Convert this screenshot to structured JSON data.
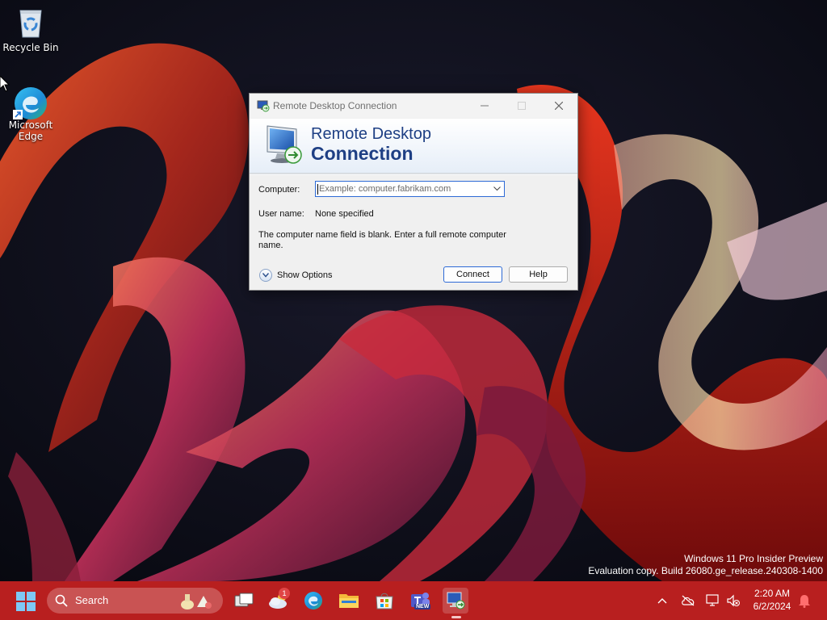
{
  "desktop": {
    "icons": [
      {
        "label": "Recycle Bin",
        "icon": "recycle-bin-icon"
      },
      {
        "label": "Microsoft\nEdge",
        "icon": "edge-icon"
      }
    ],
    "watermark": {
      "line1": "Windows 11 Pro Insider Preview",
      "line2": "Evaluation copy. Build 26080.ge_release.240308-1400"
    }
  },
  "window": {
    "title": "Remote Desktop Connection",
    "banner_line1": "Remote Desktop",
    "banner_line2": "Connection",
    "computer_label": "Computer:",
    "computer_value": "",
    "computer_placeholder": "Example: computer.fabrikam.com",
    "username_label": "User name:",
    "username_value": "None specified",
    "message": "The computer name field is blank.  Enter a full remote computer name.",
    "show_options_label": "Show Options",
    "connect_label": "Connect",
    "help_label": "Help",
    "accent": "#1e3f84"
  },
  "taskbar": {
    "search_label": "Search",
    "apps": [
      {
        "name": "task-view",
        "icon": "task-view-icon"
      },
      {
        "name": "weather",
        "icon": "weather-icon",
        "badge": "1"
      },
      {
        "name": "edge",
        "icon": "edge-icon"
      },
      {
        "name": "file-explorer",
        "icon": "folder-icon"
      },
      {
        "name": "microsoft-store",
        "icon": "store-icon"
      },
      {
        "name": "teams",
        "icon": "teams-icon",
        "tag": "NEW"
      },
      {
        "name": "remote-desktop",
        "icon": "remote-desktop-icon",
        "active": true
      }
    ],
    "clock_time": "2:20 AM",
    "clock_date": "6/2/2024",
    "color": "#b81f1f"
  }
}
